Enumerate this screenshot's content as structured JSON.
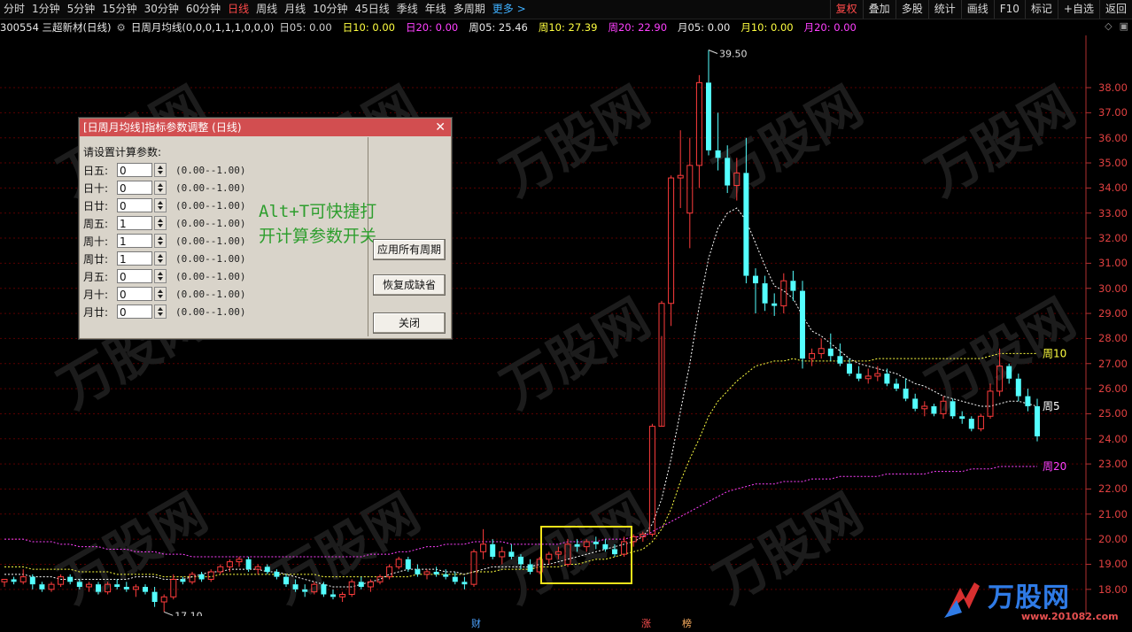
{
  "toolbar": {
    "periods": [
      "分时",
      "1分钟",
      "5分钟",
      "15分钟",
      "30分钟",
      "60分钟",
      "日线",
      "周线",
      "月线",
      "10分钟",
      "45日线",
      "季线",
      "年线",
      "多周期",
      "更多 >"
    ],
    "tools": [
      "复权",
      "叠加",
      "多股",
      "统计",
      "画线",
      "F10",
      "标记",
      "+自选",
      "返回"
    ]
  },
  "info": {
    "code_name": "300554 三超新材(日线)",
    "indicator": "日周月均线(0,0,0,1,1,1,0,0,0)",
    "values": [
      {
        "text": "日05: 0.00",
        "color": "#cfcfcf"
      },
      {
        "text": "日10: 0.00",
        "color": "#ffff40"
      },
      {
        "text": "日20: 0.00",
        "color": "#ff40ff"
      },
      {
        "text": "周05: 25.46",
        "color": "#e8e8e8"
      },
      {
        "text": "周10: 27.39",
        "color": "#ffff40"
      },
      {
        "text": "周20: 22.90",
        "color": "#ff40ff"
      },
      {
        "text": "月05: 0.00",
        "color": "#e8e8e8"
      },
      {
        "text": "月10: 0.00",
        "color": "#ffff40"
      },
      {
        "text": "月20: 0.00",
        "color": "#ff40ff"
      }
    ],
    "right_icons": [
      "◇",
      "▣"
    ]
  },
  "chart_data": {
    "type": "candlestick",
    "y_ticks": [
      "38.00",
      "37.00",
      "36.00",
      "35.00",
      "34.00",
      "33.00",
      "32.00",
      "31.00",
      "30.00",
      "29.00",
      "28.00",
      "27.00",
      "26.00",
      "25.00",
      "24.00",
      "23.00",
      "22.00",
      "21.00",
      "20.00",
      "19.00",
      "18.00"
    ],
    "ylim": [
      17.5,
      39.8
    ],
    "annotations": {
      "high": "39.50",
      "low": "17.10"
    },
    "line_labels": {
      "w5": "周5",
      "w10": "周10",
      "w20": "周20"
    },
    "colors": {
      "up": "#ff3c3c",
      "down": "#54ffff",
      "flat": "#ffffff",
      "w5": "#ffffff",
      "w10": "#ffff40",
      "w20": "#ff40ff",
      "grid": "#5a0000"
    },
    "candles": [
      [
        18.3,
        18.4,
        18.1,
        18.4
      ],
      [
        18.4,
        18.5,
        18.2,
        18.3
      ],
      [
        18.3,
        18.8,
        18.2,
        18.5
      ],
      [
        18.5,
        18.6,
        18.0,
        18.2
      ],
      [
        18.2,
        18.3,
        17.9,
        18.0
      ],
      [
        18.0,
        18.3,
        17.9,
        18.2
      ],
      [
        18.2,
        18.6,
        18.1,
        18.5
      ],
      [
        18.5,
        18.6,
        18.2,
        18.3
      ],
      [
        18.3,
        18.4,
        18.0,
        18.1
      ],
      [
        18.1,
        18.3,
        17.9,
        18.2
      ],
      [
        18.2,
        18.3,
        17.8,
        17.9
      ],
      [
        17.9,
        18.3,
        17.8,
        18.2
      ],
      [
        18.2,
        18.4,
        18.0,
        18.1
      ],
      [
        18.1,
        18.3,
        17.9,
        18.0
      ],
      [
        18.0,
        18.2,
        17.7,
        18.1
      ],
      [
        18.1,
        18.2,
        17.8,
        17.9
      ],
      [
        17.9,
        18.1,
        17.3,
        17.5
      ],
      [
        17.5,
        17.8,
        17.1,
        17.7
      ],
      [
        17.7,
        18.6,
        17.6,
        18.4
      ],
      [
        18.4,
        18.5,
        18.2,
        18.3
      ],
      [
        18.3,
        18.7,
        18.2,
        18.6
      ],
      [
        18.6,
        18.7,
        18.3,
        18.4
      ],
      [
        18.4,
        18.8,
        18.3,
        18.7
      ],
      [
        18.7,
        19.0,
        18.6,
        18.9
      ],
      [
        18.9,
        19.2,
        18.7,
        19.1
      ],
      [
        19.1,
        19.3,
        18.9,
        19.2
      ],
      [
        19.2,
        19.3,
        18.7,
        18.8
      ],
      [
        18.8,
        19.0,
        18.6,
        18.9
      ],
      [
        18.9,
        19.0,
        18.6,
        18.7
      ],
      [
        18.7,
        18.8,
        18.4,
        18.5
      ],
      [
        18.5,
        18.6,
        18.1,
        18.2
      ],
      [
        18.2,
        18.4,
        17.9,
        18.0
      ],
      [
        18.0,
        18.2,
        17.7,
        17.9
      ],
      [
        17.9,
        18.3,
        17.8,
        18.2
      ],
      [
        18.2,
        18.3,
        17.7,
        17.8
      ],
      [
        17.8,
        18.0,
        17.6,
        17.7
      ],
      [
        17.7,
        17.9,
        17.5,
        17.8
      ],
      [
        17.8,
        18.4,
        17.7,
        18.3
      ],
      [
        18.3,
        18.5,
        18.0,
        18.1
      ],
      [
        18.1,
        18.4,
        17.9,
        18.3
      ],
      [
        18.3,
        18.6,
        18.2,
        18.5
      ],
      [
        18.5,
        19.0,
        18.4,
        18.9
      ],
      [
        18.9,
        19.3,
        18.8,
        19.2
      ],
      [
        19.2,
        19.3,
        18.7,
        18.8
      ],
      [
        18.8,
        19.0,
        18.5,
        18.6
      ],
      [
        18.6,
        18.8,
        18.4,
        18.7
      ],
      [
        18.7,
        18.9,
        18.5,
        18.6
      ],
      [
        18.6,
        18.8,
        18.4,
        18.5
      ],
      [
        18.5,
        18.7,
        18.2,
        18.3
      ],
      [
        18.3,
        18.5,
        18.0,
        18.2
      ],
      [
        18.2,
        19.6,
        18.1,
        19.5
      ],
      [
        19.5,
        20.4,
        19.2,
        19.8
      ],
      [
        19.8,
        20.0,
        19.2,
        19.3
      ],
      [
        19.3,
        19.7,
        19.0,
        19.5
      ],
      [
        19.5,
        19.8,
        19.2,
        19.3
      ],
      [
        19.3,
        19.4,
        18.8,
        19.0
      ],
      [
        19.0,
        19.2,
        18.6,
        18.7
      ],
      [
        18.7,
        19.3,
        18.6,
        19.2
      ],
      [
        19.2,
        19.5,
        19.0,
        19.4
      ],
      [
        19.4,
        19.7,
        19.2,
        19.5
      ],
      [
        19.0,
        20.0,
        18.9,
        19.8
      ],
      [
        19.8,
        20.0,
        19.5,
        19.7
      ],
      [
        19.7,
        20.0,
        19.5,
        19.9
      ],
      [
        19.9,
        20.1,
        19.6,
        19.8
      ],
      [
        19.8,
        20.0,
        19.5,
        19.6
      ],
      [
        19.6,
        19.8,
        19.3,
        19.4
      ],
      [
        19.4,
        20.1,
        19.3,
        19.9
      ],
      [
        19.9,
        20.2,
        19.7,
        20.1
      ],
      [
        20.1,
        20.3,
        19.9,
        20.2
      ],
      [
        20.2,
        24.6,
        20.1,
        24.5
      ],
      [
        24.5,
        29.5,
        28.1,
        29.4
      ],
      [
        29.4,
        34.5,
        28.5,
        34.4
      ],
      [
        34.4,
        36.3,
        33.2,
        34.5
      ],
      [
        33.0,
        36.0,
        31.6,
        34.9
      ],
      [
        34.9,
        38.5,
        34.0,
        38.2
      ],
      [
        38.2,
        39.5,
        35.3,
        35.5
      ],
      [
        35.5,
        37.0,
        34.7,
        35.2
      ],
      [
        35.2,
        35.7,
        33.8,
        34.1
      ],
      [
        34.1,
        35.2,
        33.5,
        34.6
      ],
      [
        34.6,
        36.0,
        30.2,
        30.5
      ],
      [
        30.5,
        30.8,
        29.0,
        30.2
      ],
      [
        30.2,
        30.5,
        29.1,
        29.4
      ],
      [
        29.4,
        29.8,
        28.9,
        29.3
      ],
      [
        29.3,
        30.6,
        29.0,
        30.3
      ],
      [
        30.3,
        30.7,
        29.5,
        29.9
      ],
      [
        29.9,
        30.3,
        26.8,
        27.2
      ],
      [
        27.2,
        27.6,
        26.9,
        27.4
      ],
      [
        27.4,
        28.0,
        27.2,
        27.6
      ],
      [
        27.6,
        28.2,
        27.1,
        27.3
      ],
      [
        27.3,
        27.8,
        26.9,
        27.0
      ],
      [
        27.0,
        27.2,
        26.5,
        26.6
      ],
      [
        26.6,
        26.9,
        26.3,
        26.4
      ],
      [
        26.4,
        26.8,
        26.2,
        26.5
      ],
      [
        26.5,
        26.9,
        26.3,
        26.6
      ],
      [
        26.6,
        26.8,
        26.1,
        26.2
      ],
      [
        26.2,
        26.4,
        25.9,
        26.0
      ],
      [
        26.0,
        26.4,
        25.5,
        25.6
      ],
      [
        25.6,
        25.8,
        25.1,
        25.2
      ],
      [
        25.2,
        25.5,
        24.9,
        25.3
      ],
      [
        25.3,
        25.4,
        24.9,
        25.0
      ],
      [
        25.0,
        25.7,
        24.8,
        25.5
      ],
      [
        25.5,
        25.6,
        24.8,
        24.9
      ],
      [
        24.9,
        25.1,
        24.6,
        24.8
      ],
      [
        24.8,
        24.9,
        24.3,
        24.4
      ],
      [
        24.4,
        25.0,
        24.3,
        24.9
      ],
      [
        24.9,
        26.2,
        24.8,
        25.9
      ],
      [
        25.9,
        27.6,
        25.7,
        26.9
      ],
      [
        26.9,
        27.0,
        26.2,
        26.4
      ],
      [
        26.4,
        26.6,
        25.5,
        25.7
      ],
      [
        25.7,
        26.0,
        25.1,
        25.3
      ],
      [
        25.3,
        25.6,
        23.9,
        24.1
      ]
    ],
    "w5": [
      18.6,
      18.6,
      18.6,
      18.5,
      18.5,
      18.5,
      18.4,
      18.4,
      18.4,
      18.4,
      18.4,
      18.4,
      18.4,
      18.4,
      18.5,
      18.5,
      18.5,
      18.4,
      18.4,
      18.4,
      18.5,
      18.6,
      18.7,
      18.7,
      18.8,
      18.8,
      18.8,
      18.8,
      18.7,
      18.7,
      18.6,
      18.5,
      18.4,
      18.3,
      18.2,
      18.1,
      18.1,
      18.1,
      18.2,
      18.3,
      18.4,
      18.6,
      18.7,
      18.8,
      18.8,
      18.8,
      18.8,
      18.7,
      18.7,
      18.6,
      18.7,
      18.8,
      18.9,
      18.9,
      18.9,
      18.9,
      18.9,
      19.0,
      19.0,
      19.1,
      19.2,
      19.3,
      19.4,
      19.5,
      19.6,
      19.7,
      19.8,
      19.9,
      20.1,
      20.6,
      21.6,
      23.2,
      25.1,
      27.0,
      29.3,
      31.2,
      32.4,
      33.0,
      33.2,
      32.7,
      31.8,
      30.9,
      30.1,
      29.9,
      29.6,
      28.9,
      28.3,
      28.1,
      27.8,
      27.5,
      27.2,
      27.0,
      26.9,
      26.8,
      26.7,
      26.6,
      26.4,
      26.2,
      26.1,
      25.9,
      25.7,
      25.6,
      25.5,
      25.4,
      25.3,
      25.3,
      25.4,
      25.5,
      25.5,
      25.4,
      25.3
    ],
    "w10": [
      18.9,
      18.9,
      18.9,
      18.8,
      18.8,
      18.8,
      18.8,
      18.8,
      18.7,
      18.7,
      18.7,
      18.7,
      18.6,
      18.6,
      18.6,
      18.6,
      18.6,
      18.5,
      18.5,
      18.5,
      18.5,
      18.5,
      18.5,
      18.6,
      18.6,
      18.6,
      18.6,
      18.6,
      18.6,
      18.6,
      18.6,
      18.6,
      18.6,
      18.6,
      18.5,
      18.5,
      18.5,
      18.5,
      18.5,
      18.5,
      18.5,
      18.5,
      18.5,
      18.5,
      18.6,
      18.6,
      18.6,
      18.6,
      18.6,
      18.6,
      18.7,
      18.7,
      18.7,
      18.8,
      18.8,
      18.8,
      18.8,
      18.9,
      18.9,
      18.9,
      19.0,
      19.0,
      19.1,
      19.2,
      19.2,
      19.3,
      19.4,
      19.5,
      19.6,
      19.9,
      20.4,
      21.2,
      22.3,
      23.2,
      24.0,
      24.9,
      25.5,
      25.9,
      26.3,
      26.6,
      26.9,
      27.0,
      27.1,
      27.1,
      27.2,
      27.1,
      27.1,
      27.1,
      27.1,
      27.1,
      27.1,
      27.1,
      27.1,
      27.2,
      27.2,
      27.2,
      27.2,
      27.2,
      27.2,
      27.2,
      27.2,
      27.2,
      27.2,
      27.2,
      27.2,
      27.3,
      27.4,
      27.4,
      27.4,
      27.4,
      27.4
    ],
    "w20": [
      20.0,
      20.0,
      20.0,
      19.9,
      19.9,
      19.9,
      19.8,
      19.8,
      19.7,
      19.7,
      19.7,
      19.6,
      19.6,
      19.6,
      19.5,
      19.5,
      19.5,
      19.4,
      19.4,
      19.4,
      19.3,
      19.3,
      19.3,
      19.3,
      19.3,
      19.3,
      19.3,
      19.3,
      19.3,
      19.3,
      19.3,
      19.3,
      19.3,
      19.3,
      19.3,
      19.3,
      19.3,
      19.3,
      19.3,
      19.4,
      19.4,
      19.4,
      19.5,
      19.5,
      19.6,
      19.7,
      19.7,
      19.8,
      19.8,
      19.8,
      19.9,
      19.9,
      19.9,
      19.9,
      19.8,
      19.8,
      19.8,
      19.8,
      19.8,
      19.8,
      19.9,
      19.9,
      19.9,
      19.9,
      20.0,
      20.0,
      20.0,
      20.1,
      20.1,
      20.3,
      20.5,
      20.7,
      20.9,
      21.1,
      21.3,
      21.5,
      21.7,
      21.9,
      22.0,
      22.1,
      22.2,
      22.2,
      22.2,
      22.3,
      22.3,
      22.3,
      22.4,
      22.4,
      22.4,
      22.5,
      22.5,
      22.5,
      22.5,
      22.5,
      22.6,
      22.6,
      22.6,
      22.6,
      22.6,
      22.7,
      22.7,
      22.7,
      22.7,
      22.8,
      22.8,
      22.8,
      22.9,
      22.9,
      22.9,
      22.9,
      22.9
    ]
  },
  "dialog": {
    "title": "[日周月均线]指标参数调整 (日线)",
    "close": "✕",
    "prompt": "请设置计算参数:",
    "params": [
      {
        "label": "日五:",
        "value": "0",
        "range": "(0.00--1.00)"
      },
      {
        "label": "日十:",
        "value": "0",
        "range": "(0.00--1.00)"
      },
      {
        "label": "日廿:",
        "value": "0",
        "range": "(0.00--1.00)"
      },
      {
        "label": "周五:",
        "value": "1",
        "range": "(0.00--1.00)"
      },
      {
        "label": "周十:",
        "value": "1",
        "range": "(0.00--1.00)"
      },
      {
        "label": "周廿:",
        "value": "1",
        "range": "(0.00--1.00)"
      },
      {
        "label": "月五:",
        "value": "0",
        "range": "(0.00--1.00)"
      },
      {
        "label": "月十:",
        "value": "0",
        "range": "(0.00--1.00)"
      },
      {
        "label": "月廿:",
        "value": "0",
        "range": "(0.00--1.00)"
      }
    ],
    "hint_line1": "Alt+T可快捷打",
    "hint_line2": "开计算参数开关",
    "buttons": {
      "apply_all": "应用所有周期",
      "restore": "恢复成缺省",
      "close": "关闭"
    }
  },
  "bottom_marks": [
    {
      "text": "财",
      "color": "#4da3ff"
    },
    {
      "text": "涨",
      "color": "#ff5050"
    },
    {
      "text": "榜",
      "color": "#ffb060"
    }
  ],
  "watermark": {
    "brand": "万股网",
    "url": "www.201082.com"
  }
}
